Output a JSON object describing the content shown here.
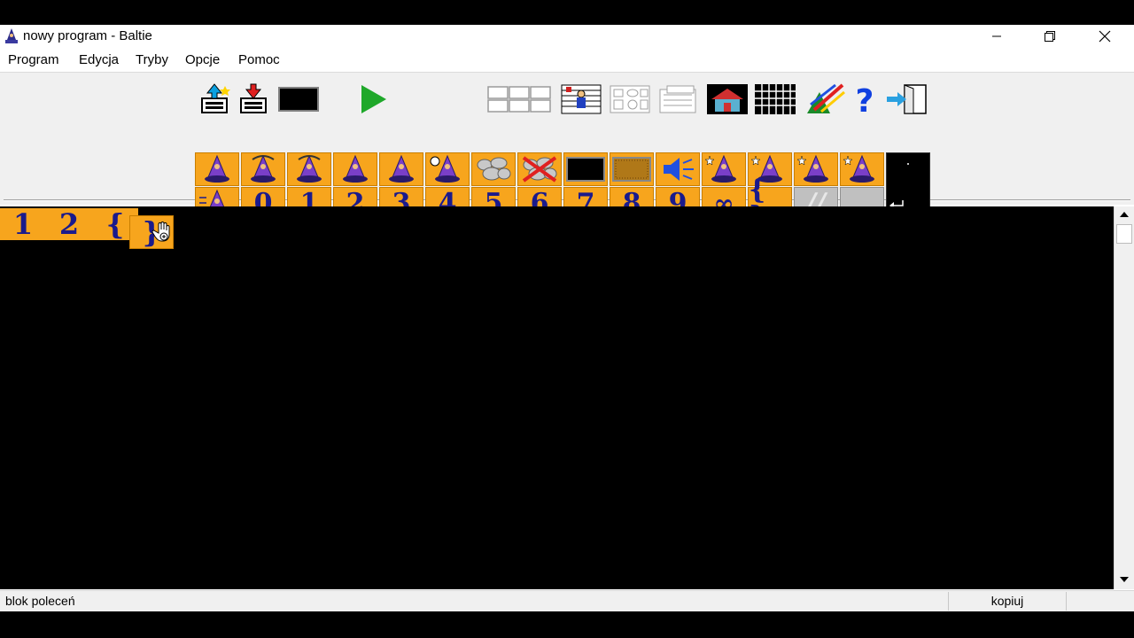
{
  "window": {
    "title": "nowy program - Baltie"
  },
  "menu": {
    "items": [
      "Program",
      "Edycja",
      "Tryby",
      "Opcje",
      "Pomoc"
    ]
  },
  "toolbar": {
    "icons": [
      "open-file-icon",
      "save-file-icon",
      "black-screen-icon",
      "run-icon",
      "grid-layout-icon",
      "scene-icon",
      "objects-icon",
      "edit-icon",
      "house-icon",
      "tiles-icon",
      "paint-icon",
      "help-icon",
      "exit-icon"
    ]
  },
  "palette": {
    "row1_icons": [
      "wizard-step-icon",
      "wizard-turn-left-icon",
      "wizard-turn-right-icon",
      "wizard-boot-icon",
      "wizard-walk-icon",
      "wizard-clock-icon",
      "stones-icon",
      "stones-crossed-icon",
      "black-box-icon",
      "patterned-box-icon",
      "speaker-icon",
      "wizard-magic-walk-icon",
      "wizard-magic-stand-icon",
      "wizard-magic-boot-icon",
      "wizard-magic-icon",
      "dark-cell-icon"
    ],
    "row2_first_icon": "wizard-run-icon",
    "numbers": [
      "0",
      "1",
      "2",
      "3",
      "4",
      "5",
      "6",
      "7",
      "8",
      "9"
    ],
    "infinity": "∞",
    "braces": "{ }",
    "comment": "//",
    "enter_icon": "enter-icon"
  },
  "program": {
    "cells": [
      "1",
      "2",
      "{",
      "}"
    ]
  },
  "statusbar": {
    "left": "blok poleceń",
    "mode": "kopiuj"
  }
}
